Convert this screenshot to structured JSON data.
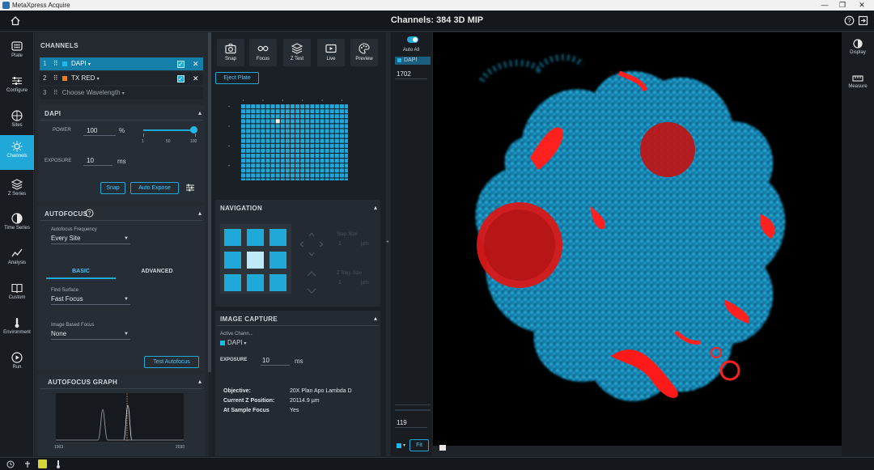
{
  "window": {
    "title": "MetaXpress Acquire",
    "controls": [
      "—",
      "❐",
      "✕"
    ]
  },
  "header": {
    "title": "Channels: 384 3D MIP"
  },
  "leftnav": {
    "items": [
      {
        "label": "Plate",
        "icon": "plate-icon"
      },
      {
        "label": "Configure",
        "icon": "sliders-icon"
      },
      {
        "label": "Sites",
        "icon": "sites-icon"
      },
      {
        "label": "Channels",
        "icon": "light-icon",
        "active": true
      },
      {
        "label": "Z Series",
        "icon": "layers-icon"
      },
      {
        "label": "Time Series",
        "icon": "clock-icon"
      },
      {
        "label": "Analysis",
        "icon": "chart-line-icon"
      },
      {
        "label": "Custom",
        "icon": "book-icon"
      },
      {
        "label": "Environment",
        "icon": "thermometer-icon"
      },
      {
        "label": "Run",
        "icon": "play-icon"
      }
    ]
  },
  "channels": {
    "header": "CHANNELS",
    "rows": [
      {
        "num": "1",
        "name": "DAPI",
        "color": "#1fa8d8",
        "checked": true
      },
      {
        "num": "2",
        "name": "TX RED",
        "color": "#e8821e",
        "checked": true
      },
      {
        "num": "3",
        "name": "Choose Wavelength",
        "color": "",
        "checked": false
      }
    ]
  },
  "dapi": {
    "header": "DAPI",
    "power_label": "POWER",
    "power_value": "100",
    "power_unit": "%",
    "slider_ticks": [
      "1",
      "50",
      "100"
    ],
    "slider_level": 1.0,
    "exposure_label": "EXPOSURE",
    "exposure_value": "10",
    "exposure_unit": "ms",
    "snap": "Snap",
    "auto_expose": "Auto Expose"
  },
  "autofocus": {
    "header": "AUTOFOCUS",
    "freq_label": "Autofocus Frequency",
    "freq_value": "Every Site",
    "tabs": [
      "BASIC",
      "ADVANCED"
    ],
    "find_surface_label": "Find Surface",
    "find_surface_value": "Fast Focus",
    "image_focus_label": "Image Based Focus",
    "image_focus_value": "None",
    "test_button": "Test Autofocus",
    "graph_header": "AUTOFOCUS GRAPH",
    "graph_xmin": "1903",
    "graph_xmax": "2030"
  },
  "toolbar": {
    "buttons": [
      {
        "label": "Snap",
        "icon": "camera-icon"
      },
      {
        "label": "Focus",
        "icon": "glasses-icon"
      },
      {
        "label": "Z Test",
        "icon": "layers-icon"
      },
      {
        "label": "Live",
        "icon": "live-icon"
      },
      {
        "label": "Preview",
        "icon": "palette-icon"
      }
    ]
  },
  "plate": {
    "eject": "Eject Plate",
    "rows": 16,
    "cols": 24
  },
  "navigation": {
    "header": "NAVIGATION",
    "step_label": "Step Size",
    "step_value": "1",
    "step_unit": "µm",
    "zstep_label": "Z Step Size",
    "zstep_value": "1",
    "zstep_unit": "µm"
  },
  "capture": {
    "header": "IMAGE CAPTURE",
    "active_label": "Active Chann...",
    "active_value": "DAPI",
    "exposure_label": "EXPOSURE",
    "exposure_value": "10",
    "exposure_unit": "ms",
    "objective_label": "Objective:",
    "objective_value": "20X Plan Apo Lambda D",
    "z_label": "Current Z Position:",
    "z_value": "20114.9 µm",
    "sample_label": "At Sample Focus",
    "sample_value": "Yes"
  },
  "zcol": {
    "auto_all": "Auto All",
    "channel": "DAPI",
    "max": "1702",
    "min": "119",
    "fit": "Fit"
  },
  "rightnav": {
    "items": [
      {
        "label": "Display",
        "icon": "contrast-icon"
      },
      {
        "label": "Measure",
        "icon": "ruler-icon"
      }
    ]
  },
  "colors": {
    "accent": "#1fa8d8",
    "dapi": "#1fb8e8",
    "texred": "#ff1a1a"
  }
}
